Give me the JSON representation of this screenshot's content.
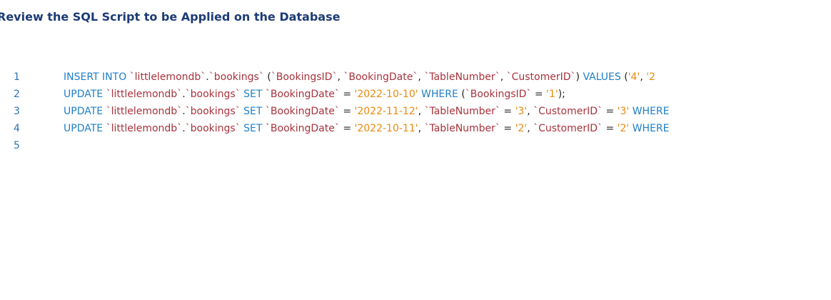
{
  "page": {
    "title": "Review the SQL Script to be Applied on the Database"
  },
  "editor": {
    "colors": {
      "keyword": "#1f7fc9",
      "identifier": "#a8323c",
      "string": "#e88a12",
      "punctuation": "#222222",
      "line_number": "#2a72b8",
      "title": "#1c3b76"
    },
    "lines": [
      {
        "number": "1",
        "tokens": [
          {
            "t": "kw",
            "v": "INSERT INTO "
          },
          {
            "t": "id",
            "v": "`littlelemondb`"
          },
          {
            "t": "pun",
            "v": "."
          },
          {
            "t": "id",
            "v": "`bookings`"
          },
          {
            "t": "pun",
            "v": " ("
          },
          {
            "t": "id",
            "v": "`BookingsID`"
          },
          {
            "t": "pun",
            "v": ", "
          },
          {
            "t": "id",
            "v": "`BookingDate`"
          },
          {
            "t": "pun",
            "v": ", "
          },
          {
            "t": "id",
            "v": "`TableNumber`"
          },
          {
            "t": "pun",
            "v": ", "
          },
          {
            "t": "id",
            "v": "`CustomerID`"
          },
          {
            "t": "pun",
            "v": ") "
          },
          {
            "t": "kw",
            "v": "VALUES "
          },
          {
            "t": "pun",
            "v": "("
          },
          {
            "t": "str",
            "v": "'4'"
          },
          {
            "t": "pun",
            "v": ", "
          },
          {
            "t": "str",
            "v": "'2"
          }
        ]
      },
      {
        "number": "2",
        "tokens": [
          {
            "t": "kw",
            "v": "UPDATE "
          },
          {
            "t": "id",
            "v": "`littlelemondb`"
          },
          {
            "t": "pun",
            "v": "."
          },
          {
            "t": "id",
            "v": "`bookings`"
          },
          {
            "t": "kw",
            "v": " SET "
          },
          {
            "t": "id",
            "v": "`BookingDate`"
          },
          {
            "t": "pun",
            "v": " = "
          },
          {
            "t": "str",
            "v": "'2022-10-10'"
          },
          {
            "t": "kw",
            "v": " WHERE "
          },
          {
            "t": "pun",
            "v": "("
          },
          {
            "t": "id",
            "v": "`BookingsID`"
          },
          {
            "t": "pun",
            "v": " = "
          },
          {
            "t": "str",
            "v": "'1'"
          },
          {
            "t": "pun",
            "v": ");"
          }
        ]
      },
      {
        "number": "3",
        "tokens": [
          {
            "t": "kw",
            "v": "UPDATE "
          },
          {
            "t": "id",
            "v": "`littlelemondb`"
          },
          {
            "t": "pun",
            "v": "."
          },
          {
            "t": "id",
            "v": "`bookings`"
          },
          {
            "t": "kw",
            "v": " SET "
          },
          {
            "t": "id",
            "v": "`BookingDate`"
          },
          {
            "t": "pun",
            "v": " = "
          },
          {
            "t": "str",
            "v": "'2022-11-12'"
          },
          {
            "t": "pun",
            "v": ", "
          },
          {
            "t": "id",
            "v": "`TableNumber`"
          },
          {
            "t": "pun",
            "v": " = "
          },
          {
            "t": "str",
            "v": "'3'"
          },
          {
            "t": "pun",
            "v": ", "
          },
          {
            "t": "id",
            "v": "`CustomerID`"
          },
          {
            "t": "pun",
            "v": " = "
          },
          {
            "t": "str",
            "v": "'3'"
          },
          {
            "t": "kw",
            "v": " WHERE"
          }
        ]
      },
      {
        "number": "4",
        "tokens": [
          {
            "t": "kw",
            "v": "UPDATE "
          },
          {
            "t": "id",
            "v": "`littlelemondb`"
          },
          {
            "t": "pun",
            "v": "."
          },
          {
            "t": "id",
            "v": "`bookings`"
          },
          {
            "t": "kw",
            "v": " SET "
          },
          {
            "t": "id",
            "v": "`BookingDate`"
          },
          {
            "t": "pun",
            "v": " = "
          },
          {
            "t": "str",
            "v": "'2022-10-11'"
          },
          {
            "t": "pun",
            "v": ", "
          },
          {
            "t": "id",
            "v": "`TableNumber`"
          },
          {
            "t": "pun",
            "v": " = "
          },
          {
            "t": "str",
            "v": "'2'"
          },
          {
            "t": "pun",
            "v": ", "
          },
          {
            "t": "id",
            "v": "`CustomerID`"
          },
          {
            "t": "pun",
            "v": " = "
          },
          {
            "t": "str",
            "v": "'2'"
          },
          {
            "t": "kw",
            "v": " WHERE"
          }
        ]
      },
      {
        "number": "5",
        "tokens": []
      }
    ]
  }
}
